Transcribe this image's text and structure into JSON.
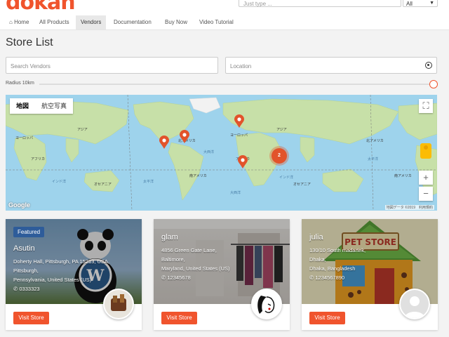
{
  "header": {
    "logo_text": "dokan",
    "search_placeholder": "Just type ...",
    "category_select": "All"
  },
  "nav": {
    "items": [
      {
        "label": "Home",
        "icon": "home-icon"
      },
      {
        "label": "All Products"
      },
      {
        "label": "Vendors",
        "active": true
      },
      {
        "label": "Documentation"
      },
      {
        "label": "Buy Now"
      },
      {
        "label": "Video Tutorial"
      }
    ]
  },
  "page": {
    "title": "Store List"
  },
  "filters": {
    "search_placeholder": "Search Vendors",
    "location_placeholder": "Location",
    "radius_label": "Radius 10km",
    "radius_fill": 1.0
  },
  "map": {
    "type_map": "地図",
    "type_satellite": "航空写真",
    "cluster_count": "2",
    "labels": {
      "asia_left": "アジア",
      "europe_left": "ヨーロッパ",
      "africa_left": "アフリカ",
      "indian_ocean_left": "インド洋",
      "oceania_left": "オセアニア",
      "atlantic_north": "大西洋",
      "pacific_left": "太平洋",
      "south_america": "南アメリカ",
      "atlantic_south": "大西洋",
      "north_america": "北アメリカ",
      "asia_center": "アジア",
      "europe_center": "ヨーロッパ",
      "africa_center": "アフリカ",
      "indian_ocean_center": "インド洋",
      "oceania_center": "オセアニア",
      "pacific_right": "太平洋",
      "north_america_right": "北アメリカ",
      "south_america_right": "南アメリカ"
    },
    "google": "Google",
    "credit": "地図データ ©2019　利用規約",
    "colors": {
      "water": "#9ed3ec",
      "land": "#c7e0a8",
      "marker": "#e2532b"
    }
  },
  "stores": [
    {
      "name": "Asutin",
      "featured": "Featured",
      "address": [
        "Doherty Hall, Pittsburgh, PA 15213, USA,",
        "Pittsburgh,",
        "Pennsylvania, United States (US)"
      ],
      "phone": "0333323",
      "button": "Visit Store"
    },
    {
      "name": "glam",
      "address": [
        "4856 Green Gate Lane,",
        "Baltimore,",
        "Maryland, United States (US)"
      ],
      "phone": "12345678",
      "button": "Visit Store"
    },
    {
      "name": "julia",
      "address": [
        "130/10 South madartek,",
        "Dhaka,",
        "Dhaka, Bangladesh"
      ],
      "phone": "1234567890",
      "button": "Visit Store",
      "sign": "PET STORE"
    }
  ]
}
